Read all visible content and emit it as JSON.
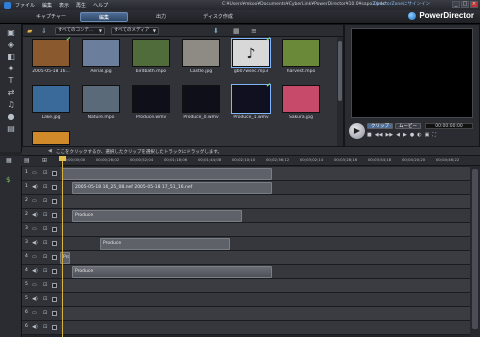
{
  "menu": [
    "ファイル",
    "編集",
    "表示",
    "再生",
    "ヘルプ"
  ],
  "document_path": "C:¥Users¥mkoo¥Documents¥CyberLink¥PowerDirector¥10.0¥sapo2.pds*",
  "window_buttons": [
    "_",
    "□",
    "×"
  ],
  "mode_tabs": [
    "キャプチャー",
    "編集",
    "出力",
    "ディスク作成"
  ],
  "signin": "DirectorZoneにサインイン",
  "brand": "PowerDirector",
  "library": {
    "filter_content": "すべてのコンテ...",
    "filter_media": "すべてのメディア",
    "items": [
      {
        "caption": "2005-05-18 16...",
        "color": "#8a5a2e",
        "checked": true
      },
      {
        "caption": "Aerial.jpg",
        "color": "#6b7f9c",
        "checked": false
      },
      {
        "caption": "birdbath.mpo",
        "color": "#4f6c3a",
        "checked": false
      },
      {
        "caption": "Castle.jpg",
        "color": "#8e8a84",
        "checked": false
      },
      {
        "caption": "gb07wsec.mp3",
        "color": "#d8d8d8",
        "checked": true
      },
      {
        "caption": "harvest.mpo",
        "color": "#6a8a3a",
        "checked": false
      },
      {
        "caption": "Lake.jpg",
        "color": "#3a6a9a",
        "checked": false
      },
      {
        "caption": "Nature.mpo",
        "color": "#5a6a78",
        "checked": false
      },
      {
        "caption": "Produce.wmv",
        "color": "#0f0f1a",
        "checked": false
      },
      {
        "caption": "Produce_0.wmv",
        "color": "#0f0f1a",
        "checked": false
      },
      {
        "caption": "Produce_1.wmv",
        "color": "#101020",
        "checked": true
      },
      {
        "caption": "Sakura.jpg",
        "color": "#c84a6a",
        "checked": false
      },
      {
        "caption": "",
        "color": "#d08a2a",
        "checked": false
      }
    ]
  },
  "preview": {
    "tab_clip": "クリップ",
    "tab_movie": "ムービー",
    "timecode": "00:00:00:00",
    "controls": [
      "■",
      "◀◀",
      "▶▶",
      "◀",
      "▶",
      "●",
      "◐",
      "▣",
      "⛶"
    ]
  },
  "hint": "ここをクリックするか、選択したクリップを選択したトラックにドラッグします。",
  "timeline": {
    "ticks": [
      "00;00;00;00",
      "00;00;26;02",
      "00;00;52;04",
      "00;01;18;06",
      "00;01;44;08",
      "00;02;10;10",
      "00;02;36;12",
      "00;03;02;14",
      "00;03;28;16",
      "00;03;54;18",
      "00;04;20;20",
      "00;04;46;22"
    ],
    "tracks": [
      {
        "num": "1",
        "kind": "video"
      },
      {
        "num": "1",
        "kind": "audio"
      },
      {
        "num": "2",
        "kind": "video"
      },
      {
        "num": "2",
        "kind": "audio"
      },
      {
        "num": "3",
        "kind": "video"
      },
      {
        "num": "3",
        "kind": "audio"
      },
      {
        "num": "4",
        "kind": "video"
      },
      {
        "num": "4",
        "kind": "audio"
      },
      {
        "num": "5",
        "kind": "video"
      },
      {
        "num": "5",
        "kind": "audio"
      },
      {
        "num": "6",
        "kind": "video"
      },
      {
        "num": "6",
        "kind": "audio"
      }
    ],
    "clips": [
      {
        "label": "",
        "track": 0
      },
      {
        "label": "2005-05-18 16_25_08.nef 2005-05-18 17_51_16.nef",
        "track": 1
      },
      {
        "label": "Produce",
        "track": 3
      },
      {
        "label": "Produce",
        "track": 5
      },
      {
        "label": "Produce",
        "track": 6
      },
      {
        "label": "Produce",
        "track": 7
      }
    ]
  }
}
